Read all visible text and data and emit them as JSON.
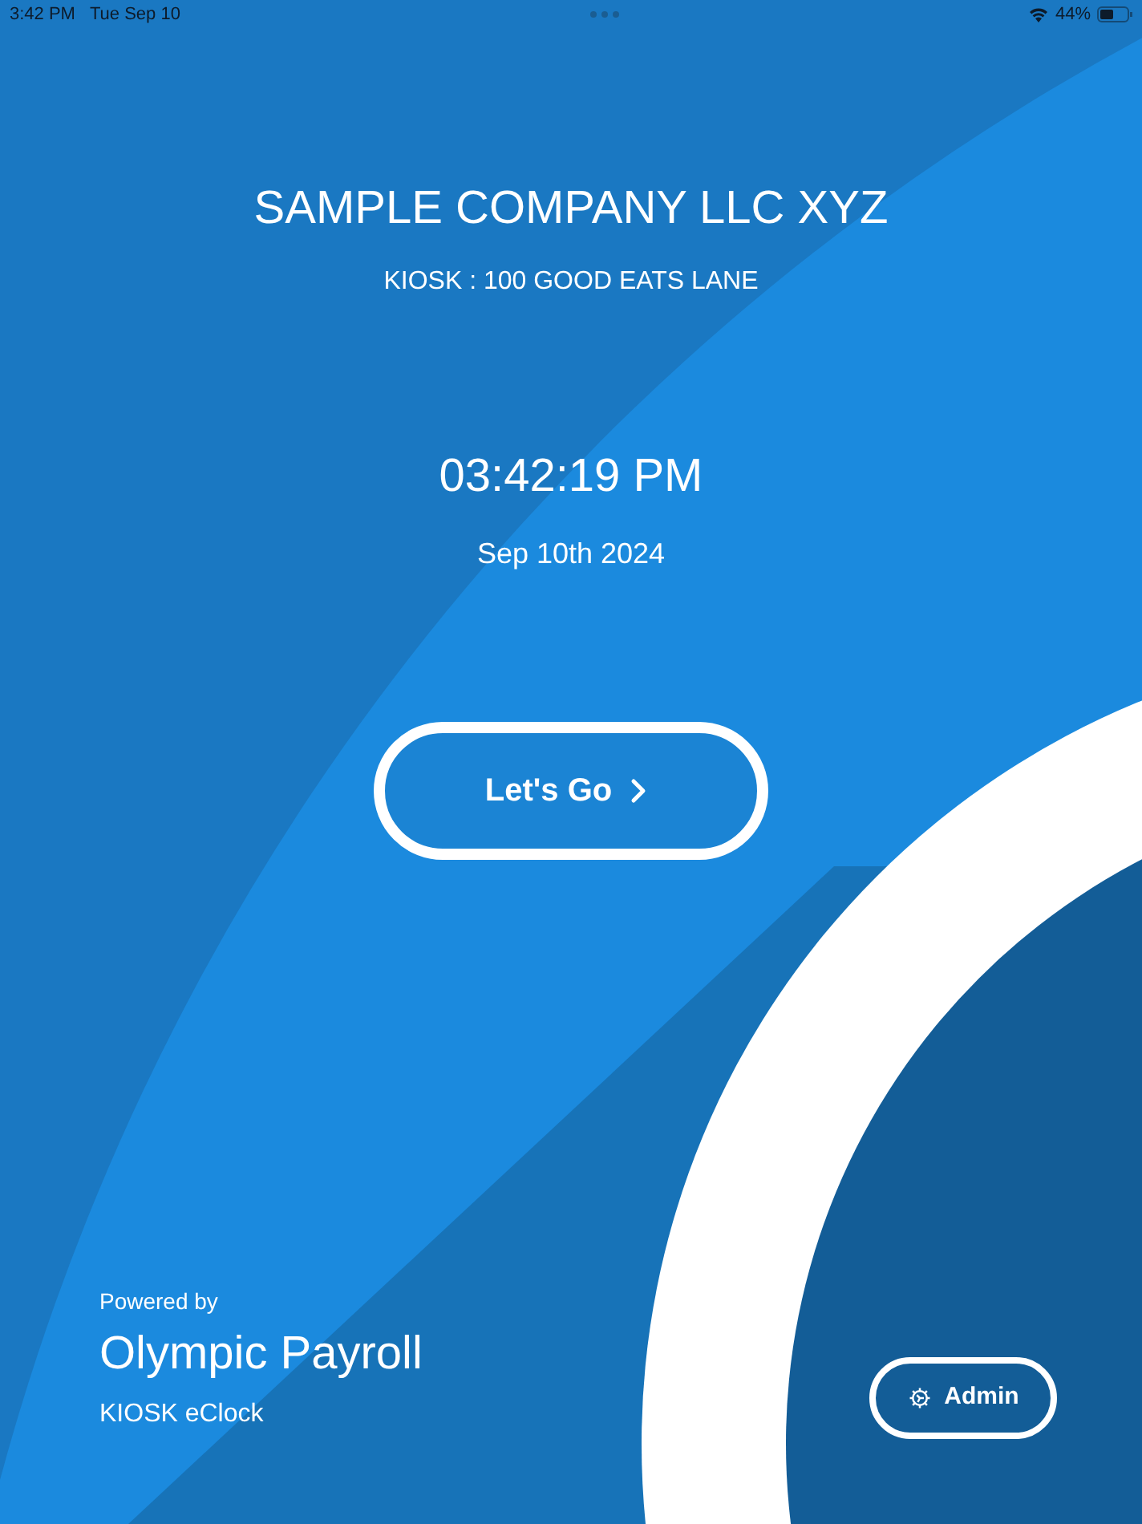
{
  "status_bar": {
    "time": "3:42 PM",
    "date": "Tue Sep 10",
    "battery": "44%"
  },
  "company": "SAMPLE COMPANY LLC XYZ",
  "kiosk": "KIOSK : 100 GOOD EATS LANE",
  "clock": "03:42:19 PM",
  "date": "Sep 10th 2024",
  "go_button": "Let's Go",
  "powered_by": "Powered by",
  "brand": "Olympic Payroll",
  "product": "KIOSK eClock",
  "admin_button": "Admin"
}
